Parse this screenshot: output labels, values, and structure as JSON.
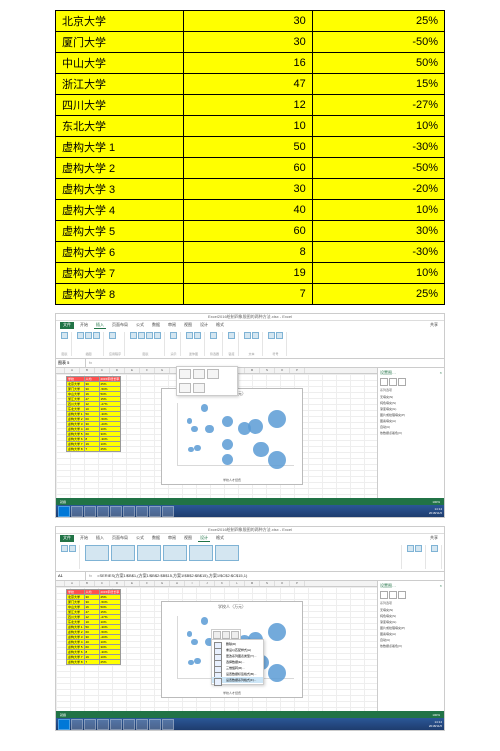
{
  "table": {
    "rows": [
      {
        "name": "北京大学",
        "v": "30",
        "p": "25%"
      },
      {
        "name": "厦门大学",
        "v": "30",
        "p": "-50%"
      },
      {
        "name": "中山大学",
        "v": "16",
        "p": "50%"
      },
      {
        "name": "浙江大学",
        "v": "47",
        "p": "15%"
      },
      {
        "name": "四川大学",
        "v": "12",
        "p": "-27%"
      },
      {
        "name": "东北大学",
        "v": "10",
        "p": "10%"
      },
      {
        "name": "虚构大学 1",
        "v": "50",
        "p": "-30%"
      },
      {
        "name": "虚构大学 2",
        "v": "60",
        "p": "-50%"
      },
      {
        "name": "虚构大学 3",
        "v": "30",
        "p": "-20%"
      },
      {
        "name": "虚构大学 4",
        "v": "40",
        "p": "10%"
      },
      {
        "name": "虚构大学 5",
        "v": "60",
        "p": "30%"
      },
      {
        "name": "虚构大学 6",
        "v": "8",
        "p": "-30%"
      },
      {
        "name": "虚构大学 7",
        "v": "19",
        "p": "10%"
      },
      {
        "name": "虚构大学 8",
        "v": "7",
        "p": "25%"
      }
    ]
  },
  "excel": {
    "title": "Excel2016绘制四象限图的两种方法.xlsx - Excel",
    "tabs": {
      "file": "文件",
      "start": "开始",
      "insert": "插入",
      "layout": "页面布局",
      "formulas": "公式",
      "data": "数据",
      "review": "审阅",
      "view": "视图",
      "design": "设计",
      "format": "格式"
    },
    "share": "共享",
    "namebox": "图表 5",
    "namebox2": "A1",
    "fx": "fx",
    "formula2": "=SERIES(方案1!$B$1,(方案1!$B$2:$B$15,方案1!$B$2:$B$15),方案1!$C$2:$C$15,1)",
    "ribbon": {
      "g1": "图表",
      "g2": "插图",
      "g3": "应用程序",
      "g4": "图表",
      "g5": "演示",
      "g6": "迷你图",
      "g7": "筛选器",
      "g8": "链接",
      "g9": "文本",
      "g10": "符号"
    },
    "mini_header": {
      "c1": "学校",
      "c2": "人均",
      "c3": "2015年增长率"
    },
    "chart_title": "学校人（万元）",
    "chart_xlabel": "学校人才经费",
    "sheet_tab": "方案1",
    "status_ready": "就绪",
    "zoom": "100%",
    "ctx": {
      "i1": "删除(D)",
      "i2": "重设以匹配样式(A)",
      "i3": "更改系列图表类型(Y)...",
      "i4": "选择数据(E)...",
      "i5": "三维旋转(R)...",
      "i6": "设置数据标签格式(B)...",
      "i7": "设置数据系列格式(F)...",
      "hl": "设置数据系列格式(F)..."
    },
    "pane": {
      "title": "设置图…",
      "close": "×",
      "h1": "系列选项",
      "o1": "无填充(N)",
      "o2": "纯色填充(S)",
      "o3": "渐变填充(G)",
      "o4": "图片或纹理填充(P)",
      "o5": "图案填充(A)",
      "o6": "自动(U)",
      "o7": "依数据点着色(V)"
    },
    "taskbar": {
      "time": "14:14",
      "date": "2018/11/6"
    }
  },
  "chart_data": {
    "type": "scatter-bubble",
    "title": "学校人（万元）",
    "xlabel": "学校人才经费",
    "x_field": "人均(万元)",
    "y_field": "2015年增长率(%)",
    "size_field": "人均(万元)",
    "points": [
      {
        "label": "北京大学",
        "x": 30,
        "y": 25,
        "size": 30
      },
      {
        "label": "厦门大学",
        "x": 30,
        "y": -50,
        "size": 30
      },
      {
        "label": "中山大学",
        "x": 16,
        "y": 50,
        "size": 16
      },
      {
        "label": "浙江大学",
        "x": 47,
        "y": 15,
        "size": 47
      },
      {
        "label": "四川大学",
        "x": 12,
        "y": -27,
        "size": 12
      },
      {
        "label": "东北大学",
        "x": 10,
        "y": 10,
        "size": 10
      },
      {
        "label": "虚构大学 1",
        "x": 50,
        "y": -30,
        "size": 50
      },
      {
        "label": "虚构大学 2",
        "x": 60,
        "y": -50,
        "size": 60
      },
      {
        "label": "虚构大学 3",
        "x": 30,
        "y": -20,
        "size": 30
      },
      {
        "label": "虚构大学 4",
        "x": 40,
        "y": 10,
        "size": 40
      },
      {
        "label": "虚构大学 5",
        "x": 60,
        "y": 30,
        "size": 60
      },
      {
        "label": "虚构大学 6",
        "x": 8,
        "y": -30,
        "size": 8
      },
      {
        "label": "虚构大学 7",
        "x": 19,
        "y": 10,
        "size": 19
      },
      {
        "label": "虚构大学 8",
        "x": 7,
        "y": 25,
        "size": 7
      }
    ],
    "xlim": [
      0,
      70
    ],
    "ylim": [
      -60,
      60
    ]
  }
}
